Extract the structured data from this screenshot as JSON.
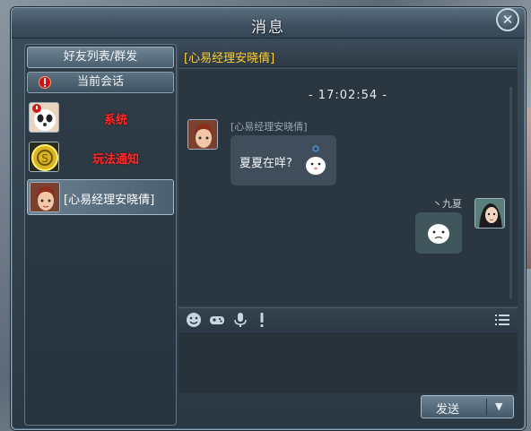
{
  "window": {
    "title": "消息",
    "close_glyph": "✕"
  },
  "sidebar": {
    "tab_friends": "好友列表/群发",
    "tab_current": "当前会话",
    "contacts": [
      {
        "name": "系统",
        "style": "red",
        "avatar": "panda-avatar"
      },
      {
        "name": "玩法通知",
        "style": "red",
        "avatar": "coin-avatar"
      },
      {
        "name": "[心易经理安晓倩]",
        "style": "active",
        "avatar": "girl-avatar"
      }
    ]
  },
  "chat": {
    "header_title": "[心易经理安晓倩]",
    "timestamp": "- 17:02:54 -",
    "sender_name": "[心易经理安晓倩]",
    "incoming_message": "夏夏在咩?",
    "self_name": "丶九夏"
  },
  "toolbar": {
    "icons": [
      "smiley-icon",
      "gamepad-icon",
      "microphone-icon",
      "exclamation-icon",
      "list-icon"
    ]
  },
  "send": {
    "label": "发送",
    "dropdown_glyph": "▼"
  },
  "colors": {
    "accent": "#ffcc33",
    "alert_red": "#ff2a2a"
  }
}
